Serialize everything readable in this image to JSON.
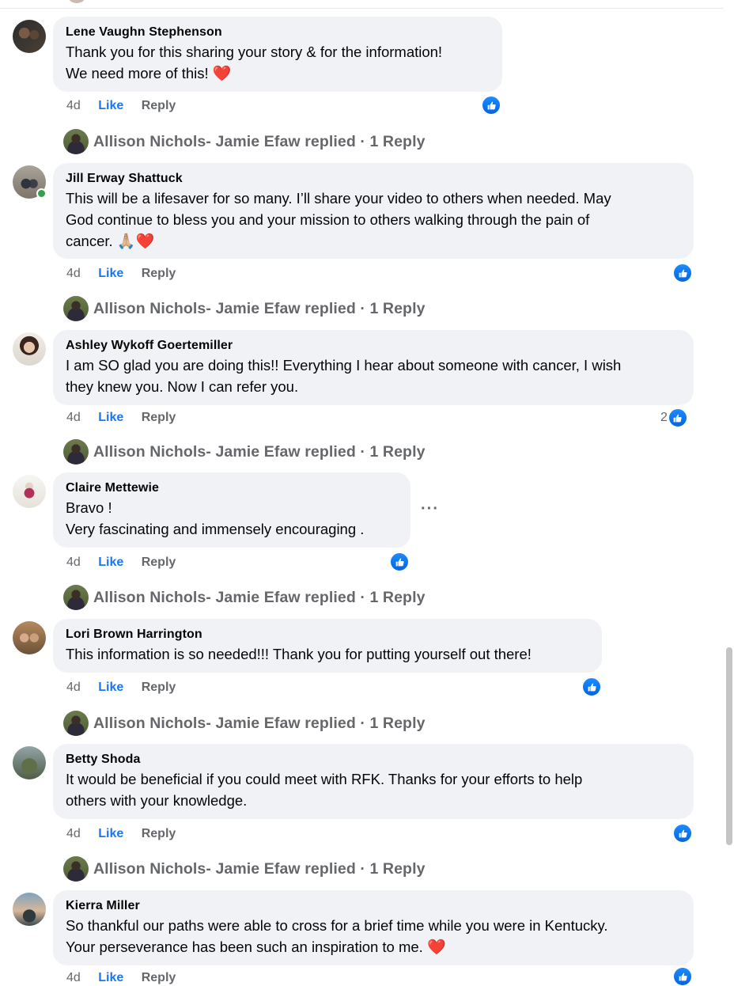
{
  "colors": {
    "bubble": "#f0f2f5",
    "like_blue": "#1877f2",
    "meta_gray": "#65676b",
    "heart_red": "#e41e3f",
    "online_green": "#31a24c"
  },
  "labels": {
    "like": "Like",
    "reply": "Reply"
  },
  "comments": [
    {
      "author": "Lene Vaughn Stephenson",
      "lines": [
        "Thank you for this sharing your story & for the information!",
        "We need more of this!"
      ],
      "emoji": "❤️",
      "time": "4d",
      "reactions": "",
      "replies": "Allison Nichols- Jamie Efaw replied · 1 Reply"
    },
    {
      "author": "Jill Erway Shattuck",
      "lines": [
        "This will be a lifesaver for so many. I’ll share your video to others when needed. May",
        "God continue to bless you and your mission to others walking through the pain of",
        "cancer."
      ],
      "emoji": "🙏🏼❤️",
      "time": "4d",
      "reactions": "",
      "replies": "Allison Nichols- Jamie Efaw replied · 1 Reply"
    },
    {
      "author": "Ashley Wykoff Goertemiller",
      "lines": [
        "I am SO glad you are doing this!! Everything I hear about someone with cancer, I wish",
        "they knew you. Now I can refer you."
      ],
      "emoji": "",
      "time": "4d",
      "reactions": "2",
      "replies": "Allison Nichols- Jamie Efaw replied · 1 Reply"
    },
    {
      "author": "Claire Mettewie",
      "lines": [
        "Bravo !",
        "Very fascinating and immensely encouraging ."
      ],
      "emoji": "",
      "time": "4d",
      "reactions": "",
      "replies": "Allison Nichols- Jamie Efaw replied · 1 Reply"
    },
    {
      "author": "Lori Brown Harrington",
      "lines": [
        "This information is so needed!!! Thank you for putting yourself out there!"
      ],
      "emoji": "",
      "time": "4d",
      "reactions": "",
      "replies": "Allison Nichols- Jamie Efaw replied · 1 Reply"
    },
    {
      "author": "Betty Shoda",
      "lines": [
        "It would be beneficial if you could meet with RFK. Thanks for your efforts to help",
        "others with your knowledge."
      ],
      "emoji": "",
      "time": "4d",
      "reactions": "",
      "replies": "Allison Nichols- Jamie Efaw replied · 1 Reply"
    },
    {
      "author": "Kierra Miller",
      "lines": [
        "So thankful our paths were able to cross for a brief time while you were in Kentucky.",
        "Your perseverance has been such an inspiration to me."
      ],
      "emoji": "❤️",
      "time": "4d",
      "reactions": "",
      "replies": ""
    }
  ]
}
